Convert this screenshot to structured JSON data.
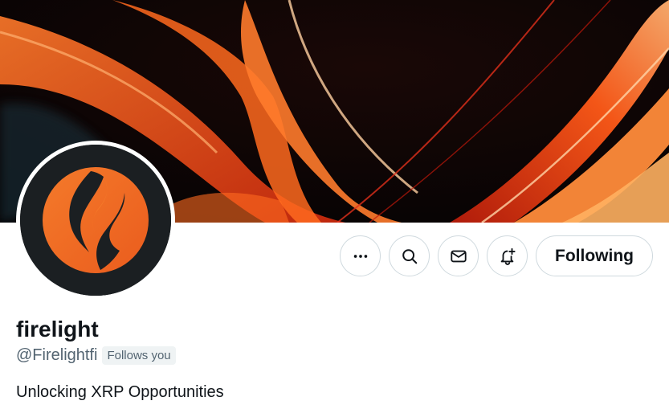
{
  "banner": {
    "image": "abstract-fire-waves-banner",
    "colors": [
      "#0b0706",
      "#ff5a14",
      "#ffb060",
      "#c0180a"
    ]
  },
  "avatar": {
    "image": "firelight-flame-logo",
    "background": "#1b1f22",
    "accent": "#f26a22"
  },
  "actions": {
    "more_icon": "more-horizontal-icon",
    "search_icon": "search-icon",
    "message_icon": "envelope-icon",
    "notify_icon": "bell-plus-icon",
    "follow_label": "Following"
  },
  "profile": {
    "display_name": "firelight",
    "handle": "@Firelightfi",
    "follows_you": "Follows you",
    "bio": "Unlocking XRP Opportunities"
  }
}
